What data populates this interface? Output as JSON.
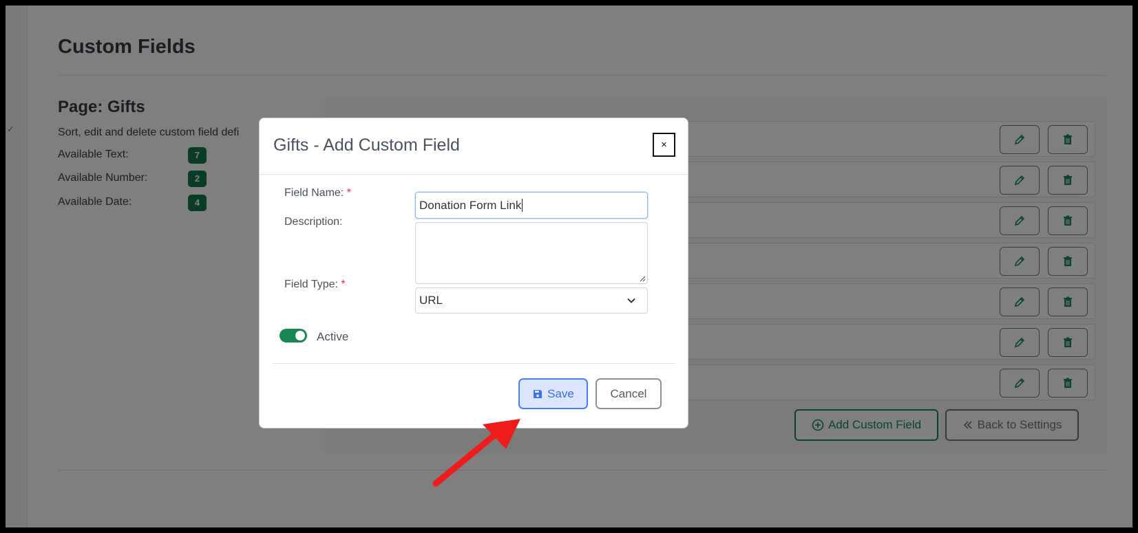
{
  "page": {
    "title": "Custom Fields",
    "subtitle": "Page: Gifts",
    "description": "Sort, edit and delete custom field defi",
    "available": [
      {
        "label": "Available Text:",
        "count": "7"
      },
      {
        "label": "Available Number:",
        "count": "2"
      },
      {
        "label": "Available Date:",
        "count": "4"
      }
    ]
  },
  "list": {
    "row_count": 7,
    "edit_icon": "pencil-icon",
    "delete_icon": "trash-icon",
    "add_button_label": "Add Custom Field",
    "back_button_label": "Back to Settings"
  },
  "modal": {
    "title": "Gifts - Add Custom Field",
    "close_label": "×",
    "field_name_label": "Field Name:",
    "field_name_value": "Donation Form Link",
    "description_label": "Description:",
    "description_value": "",
    "field_type_label": "Field Type:",
    "field_type_value": "URL",
    "required_mark": "*",
    "active_label": "Active",
    "active_on": true,
    "save_label": "Save",
    "cancel_label": "Cancel"
  },
  "colors": {
    "accent_green": "#198754",
    "badge_green": "#13794a",
    "save_blue": "#4b7cf3",
    "arrow_red": "#ee1c1c"
  }
}
